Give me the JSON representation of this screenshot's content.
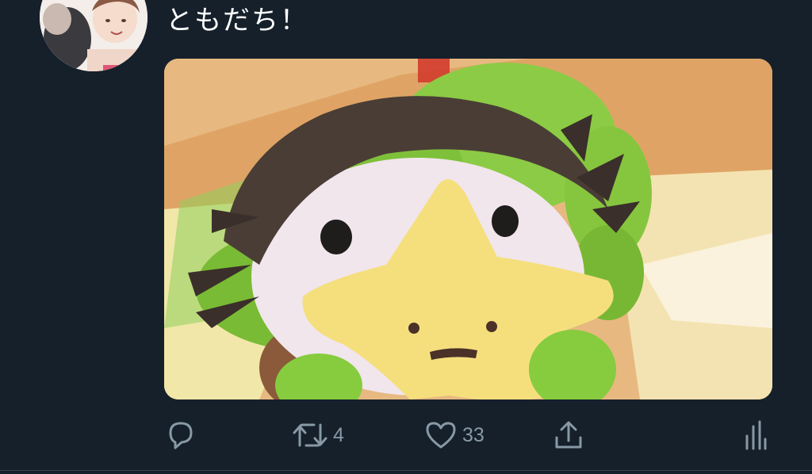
{
  "tweet": {
    "text": "ともだち！"
  },
  "actions": {
    "reply": {
      "icon": "reply-icon",
      "count": ""
    },
    "retweet": {
      "icon": "retweet-icon",
      "count": "4"
    },
    "like": {
      "icon": "heart-icon",
      "count": "33"
    },
    "share": {
      "icon": "share-icon"
    },
    "analytics": {
      "icon": "analytics-icon"
    }
  },
  "colors": {
    "background": "#15202b",
    "text": "#ffffff",
    "icon": "#8899a6",
    "divider": "#38444d"
  }
}
